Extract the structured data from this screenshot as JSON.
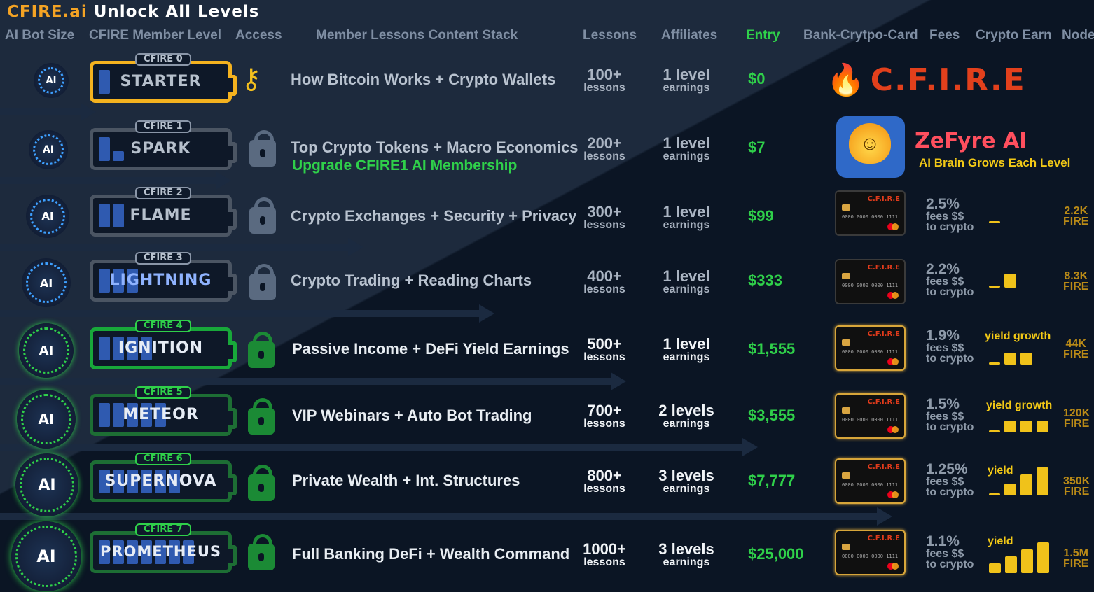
{
  "title": {
    "brand": "CFIRE.ai",
    "rest": "Unlock All Levels"
  },
  "headers": {
    "ai_bot_size": "AI Bot Size",
    "member_level": "CFIRE Member Level",
    "access": "Access",
    "content_stack": "Member Lessons Content Stack",
    "lessons": "Lessons",
    "affiliates": "Affiliates",
    "entry": "Entry",
    "bank_card": "Bank-Crytpo-Card",
    "fees": "Fees",
    "crypto_earn": "Crypto Earn",
    "node": "Node"
  },
  "logos": {
    "cfire_logo": "C.F.I.R.E",
    "zefyre_name": "ZeFyre AI",
    "zefyre_tagline": "AI Brain Grows Each Level"
  },
  "card": {
    "brand": "C.F.I.R.E",
    "number": "0000 0000 0000 1111",
    "holder": "CFIRE Member"
  },
  "colors": {
    "gold": "#f4a324",
    "green": "#2fd04a",
    "blue_cell": "#2f5ab0",
    "card_fire": "#e2401c"
  },
  "levels": [
    {
      "tag": "CFIRE 0",
      "name": "STARTER",
      "access": "key-icon",
      "content": "How Bitcoin Works + Crypto Wallets",
      "lessons_big": "100+",
      "lessons_small": "lessons",
      "aff_big": "1 level",
      "aff_small": "earnings",
      "entry": "$0"
    },
    {
      "tag": "CFIRE 1",
      "name": "SPARK",
      "access": "lock-icon",
      "content": "Top Crypto Tokens + Macro Economics",
      "upgrade": "Upgrade CFIRE1 AI Membership",
      "lessons_big": "200+",
      "lessons_small": "lessons",
      "aff_big": "1 level",
      "aff_small": "earnings",
      "entry": "$7"
    },
    {
      "tag": "CFIRE 2",
      "name": "FLAME",
      "access": "lock-icon",
      "content": "Crypto Exchanges + Security + Privacy",
      "lessons_big": "300+",
      "lessons_small": "lessons",
      "aff_big": "1 level",
      "aff_small": "earnings",
      "entry": "$99",
      "fee": "2.5%",
      "fee_l2": "fees $$",
      "fee_l3": "to crypto",
      "node_big": "2.2K",
      "node_small": "FIRE"
    },
    {
      "tag": "CFIRE 3",
      "name": "LIGHTNING",
      "access": "lock-icon",
      "content": "Crypto Trading + Reading Charts",
      "lessons_big": "400+",
      "lessons_small": "lessons",
      "aff_big": "1 level",
      "aff_small": "earnings",
      "entry": "$333",
      "fee": "2.2%",
      "fee_l2": "fees $$",
      "fee_l3": "to crypto",
      "node_big": "8.3K",
      "node_small": "FIRE"
    },
    {
      "tag": "CFIRE 4",
      "name": "IGNITION",
      "access": "lock-icon",
      "content": "Passive Income + DeFi Yield Earnings",
      "lessons_big": "500+",
      "lessons_small": "lessons",
      "aff_big": "1 level",
      "aff_small": "earnings",
      "entry": "$1,555",
      "fee": "1.9%",
      "fee_l2": "fees $$",
      "fee_l3": "to crypto",
      "yield": "yield growth",
      "node_big": "44K",
      "node_small": "FIRE"
    },
    {
      "tag": "CFIRE 5",
      "name": "METEOR",
      "access": "lock-icon",
      "content": "VIP Webinars + Auto Bot Trading",
      "lessons_big": "700+",
      "lessons_small": "lessons",
      "aff_big": "2 levels",
      "aff_small": "earnings",
      "entry": "$3,555",
      "fee": "1.5%",
      "fee_l2": "fees $$",
      "fee_l3": "to crypto",
      "yield": "yield growth",
      "node_big": "120K",
      "node_small": "FIRE"
    },
    {
      "tag": "CFIRE 6",
      "name": "SUPERNOVA",
      "access": "lock-icon",
      "content": "Private Wealth + Int. Structures",
      "lessons_big": "800+",
      "lessons_small": "lessons",
      "aff_big": "3 levels",
      "aff_small": "earnings",
      "entry": "$7,777",
      "fee": "1.25%",
      "fee_l2": "fees $$",
      "fee_l3": "to crypto",
      "yield": "yield",
      "node_big": "350K",
      "node_small": "FIRE"
    },
    {
      "tag": "CFIRE 7",
      "name": "PROMETHEUS",
      "access": "lock-icon",
      "content": "Full Banking DeFi + Wealth Command",
      "lessons_big": "1000+",
      "lessons_small": "lessons",
      "aff_big": "3 levels",
      "aff_small": "earnings",
      "entry": "$25,000",
      "fee": "1.1%",
      "fee_l2": "fees $$",
      "fee_l3": "to crypto",
      "yield": "yield",
      "node_big": "1.5M",
      "node_small": "FIRE"
    }
  ]
}
